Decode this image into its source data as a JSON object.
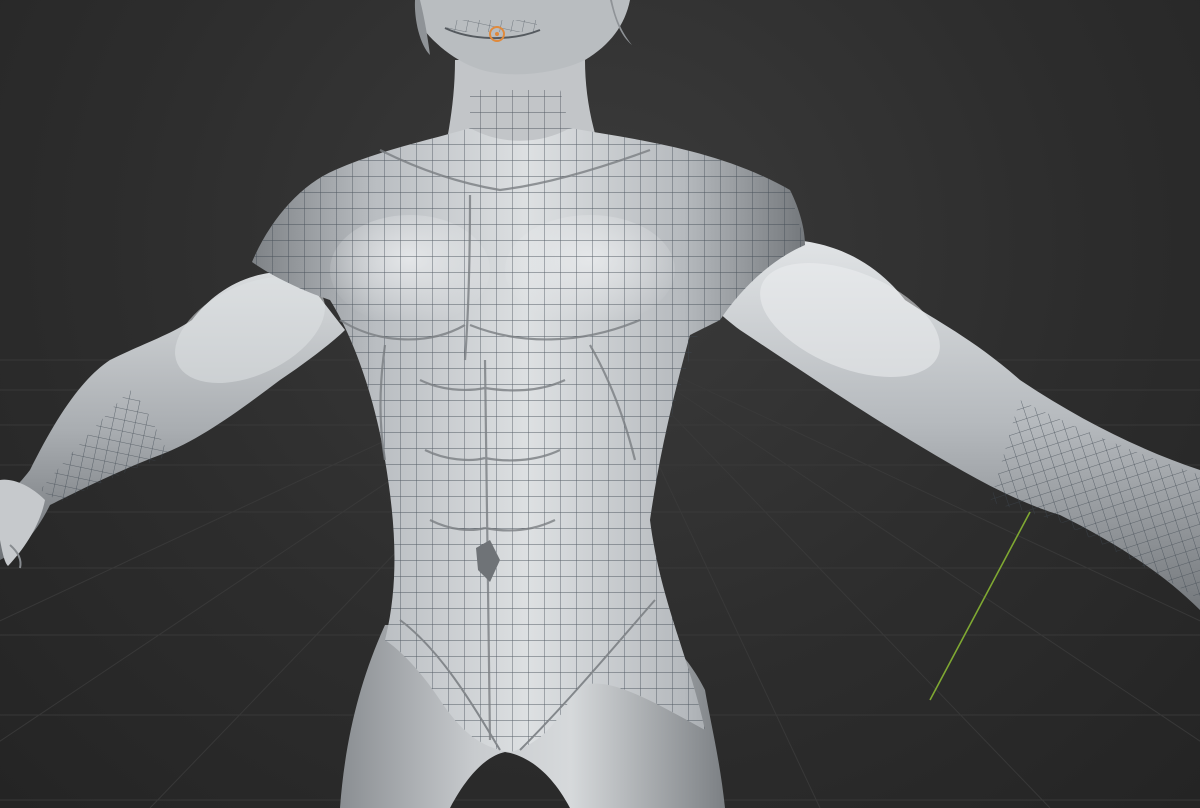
{
  "viewport": {
    "kind": "3d-viewport",
    "shading": "solid",
    "overlay": "wireframe",
    "subject": "sculpted-torso-mesh"
  },
  "colors": {
    "background": "#2b2b2b",
    "floor_grid": "#3a3a3a",
    "y_axis": "#7fa832",
    "mesh_base": "#b4b9bd",
    "mesh_highlight": "#e3e6e8",
    "mesh_shadow": "#6f7377",
    "wire": "#3d4650"
  },
  "icons": {
    "origin_marker": "origin-marker-icon"
  }
}
